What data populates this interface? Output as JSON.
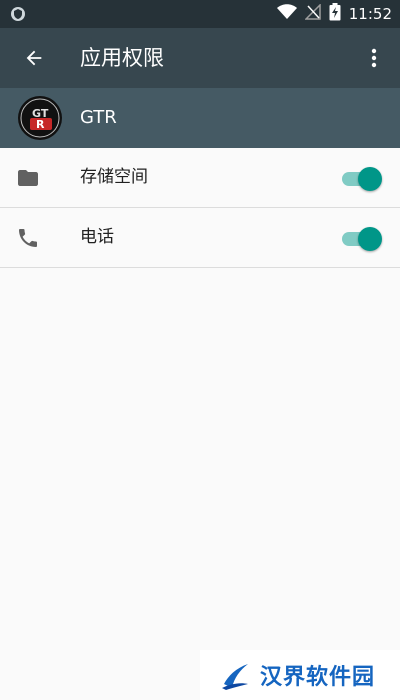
{
  "status_bar": {
    "time": "11:52",
    "icons": [
      "shield-icon",
      "wifi-icon",
      "no-signal-icon",
      "battery-charging-icon"
    ]
  },
  "toolbar": {
    "title": "应用权限",
    "back_icon": "back-arrow-icon",
    "menu_icon": "more-vert-icon"
  },
  "app": {
    "name": "GTR",
    "logo_text": "GT R"
  },
  "permissions": [
    {
      "label": "存储空间",
      "icon": "folder-icon",
      "enabled": true
    },
    {
      "label": "电话",
      "icon": "phone-icon",
      "enabled": true
    }
  ],
  "colors": {
    "status_bar": "#263238",
    "toolbar": "#37474f",
    "app_header": "#455a64",
    "switch_thumb": "#009688",
    "switch_track": "#80cbc4"
  },
  "watermark": {
    "text": "汉界软件园"
  }
}
